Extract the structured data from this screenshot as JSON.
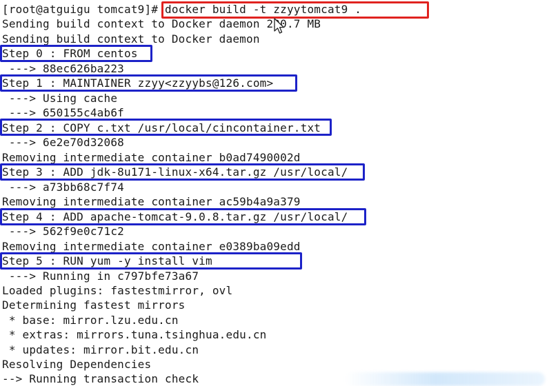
{
  "terminal": {
    "lines": [
      "[root@atguigu tomcat9]# docker build -t zzyytomcat9 .",
      "Sending build context to Docker daemon 230.7 MB",
      "Sending build context to Docker daemon",
      "Step 0 : FROM centos",
      " ---> 88ec626ba223",
      "Step 1 : MAINTAINER zzyy<zzyybs@126.com>",
      " ---> Using cache",
      " ---> 650155c4ab6f",
      "Step 2 : COPY c.txt /usr/local/cincontainer.txt",
      " ---> 6e2e70d32068",
      "Removing intermediate container b0ad7490002d",
      "Step 3 : ADD jdk-8u171-linux-x64.tar.gz /usr/local/",
      " ---> a73bb68c7f74",
      "Removing intermediate container ac59b4a9a379",
      "Step 4 : ADD apache-tomcat-9.0.8.tar.gz /usr/local/",
      " ---> 562f9e0c71c2",
      "Removing intermediate container e0389ba09edd",
      "Step 5 : RUN yum -y install vim",
      " ---> Running in c797bfe73a67",
      "Loaded plugins: fastestmirror, ovl",
      "Determining fastest mirrors",
      " * base: mirror.lzu.edu.cn",
      " * extras: mirrors.tuna.tsinghua.edu.cn",
      " * updates: mirror.bit.edu.cn",
      "Resolving Dependencies",
      "--> Running transaction check"
    ]
  },
  "annotations": {
    "command_highlight_color": "#e0221f",
    "step_highlight_color": "#1c22c8"
  }
}
